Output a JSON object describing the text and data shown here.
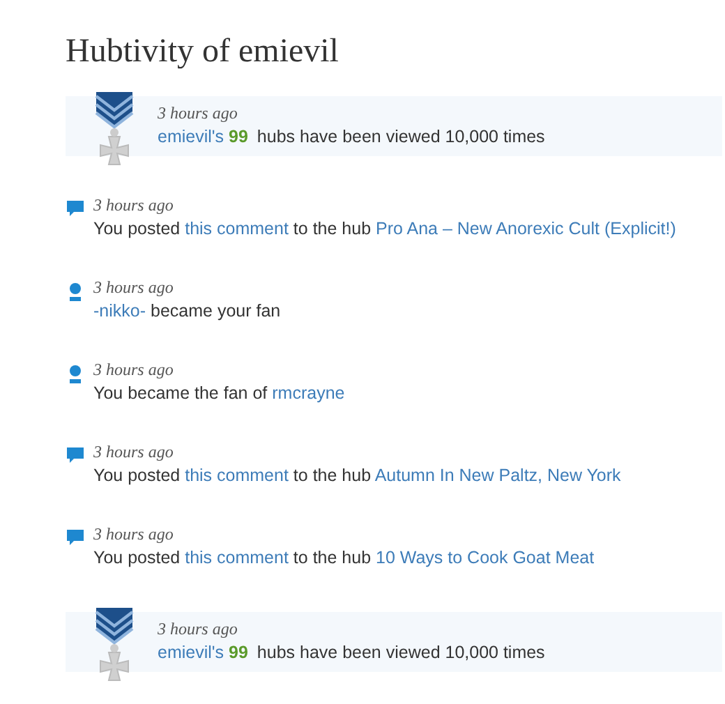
{
  "title": "Hubtivity of emievil",
  "items": [
    {
      "kind": "award",
      "time": "3 hours ago",
      "parts": [
        {
          "kind": "link",
          "text": "emievil's"
        },
        {
          "kind": "count",
          "text": "99"
        },
        {
          "kind": "text",
          "text": "hubs have been viewed 10,000 times"
        }
      ]
    },
    {
      "kind": "comment",
      "time": "3 hours ago",
      "parts": [
        {
          "kind": "text",
          "text": "You posted"
        },
        {
          "kind": "link",
          "text": "this comment"
        },
        {
          "kind": "text",
          "text": "to the hub"
        },
        {
          "kind": "link",
          "text": "Pro Ana – New Anorexic Cult (Explicit!)"
        }
      ]
    },
    {
      "kind": "fan",
      "time": "3 hours ago",
      "parts": [
        {
          "kind": "link",
          "text": "-nikko-"
        },
        {
          "kind": "text",
          "text": "became your fan"
        }
      ]
    },
    {
      "kind": "fan",
      "time": "3 hours ago",
      "parts": [
        {
          "kind": "text",
          "text": "You became the fan of"
        },
        {
          "kind": "link",
          "text": "rmcrayne"
        }
      ]
    },
    {
      "kind": "comment",
      "time": "3 hours ago",
      "parts": [
        {
          "kind": "text",
          "text": "You posted"
        },
        {
          "kind": "link",
          "text": "this comment"
        },
        {
          "kind": "text",
          "text": "to the hub"
        },
        {
          "kind": "link",
          "text": "Autumn In New Paltz, New York"
        }
      ]
    },
    {
      "kind": "comment",
      "time": "3 hours ago",
      "parts": [
        {
          "kind": "text",
          "text": "You posted"
        },
        {
          "kind": "link",
          "text": "this comment"
        },
        {
          "kind": "text",
          "text": "to the hub"
        },
        {
          "kind": "link",
          "text": "10 Ways to Cook Goat Meat"
        }
      ]
    },
    {
      "kind": "award",
      "time": "3 hours ago",
      "parts": [
        {
          "kind": "link",
          "text": "emievil's"
        },
        {
          "kind": "count",
          "text": "99"
        },
        {
          "kind": "text",
          "text": "hubs have been viewed 10,000 times"
        }
      ]
    }
  ]
}
